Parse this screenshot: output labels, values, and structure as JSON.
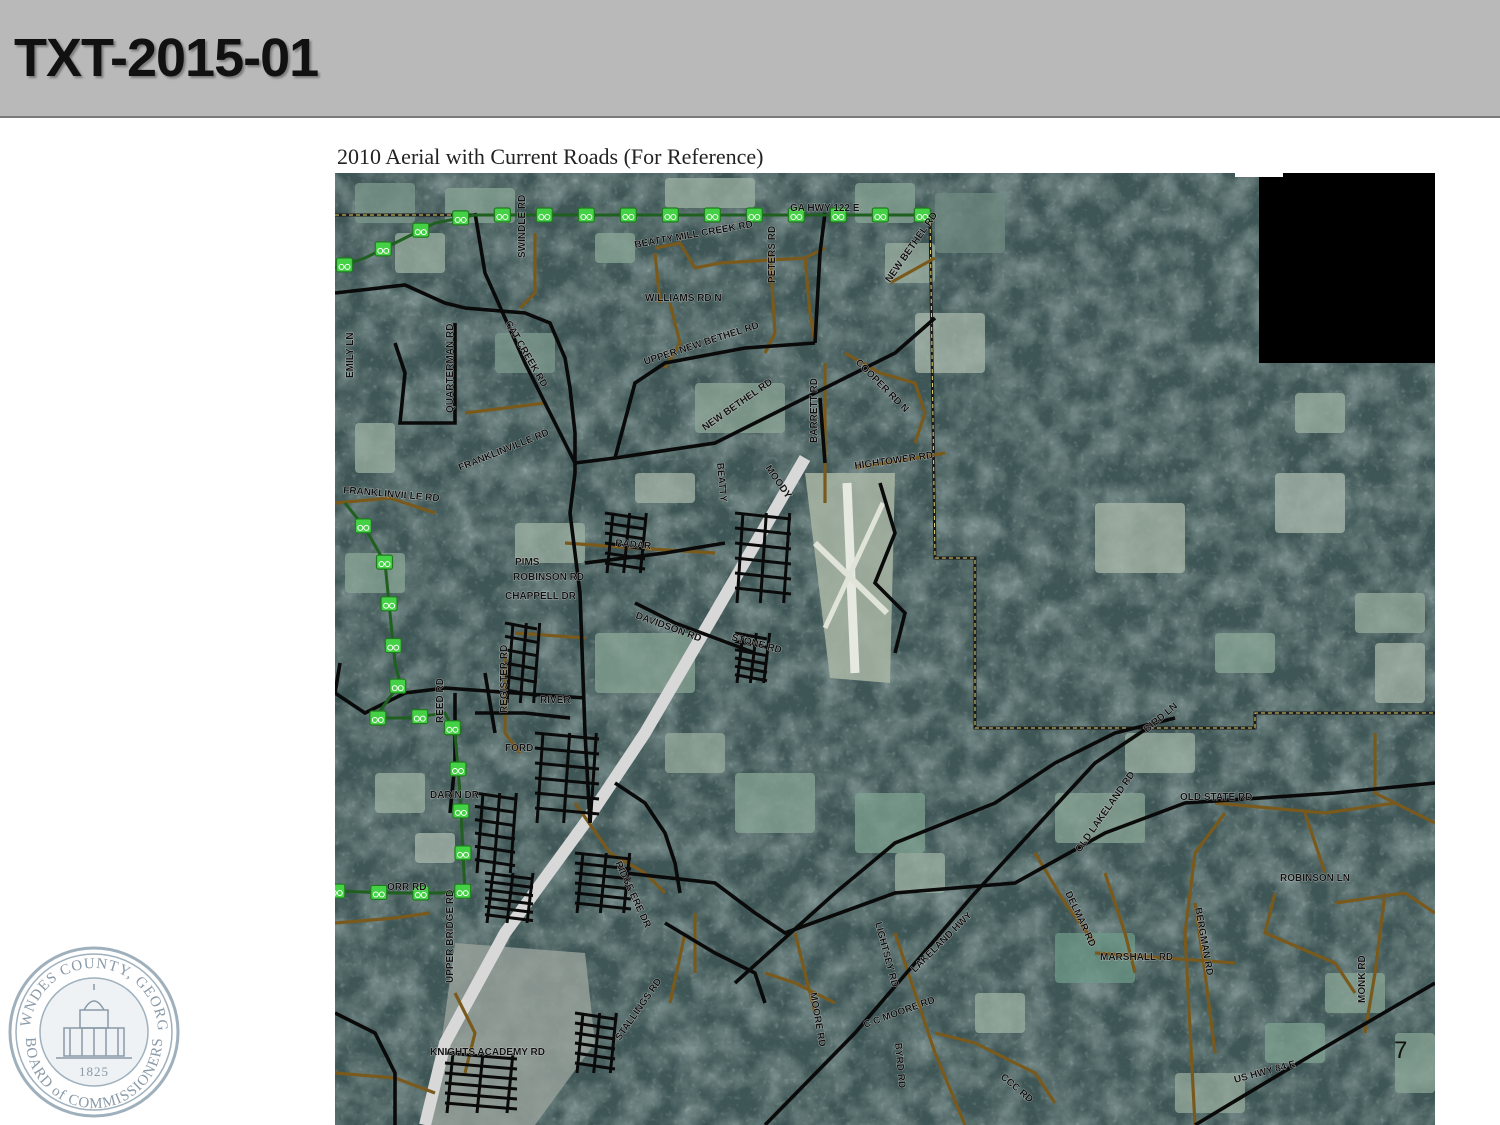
{
  "header": {
    "title": "TXT-2015-01"
  },
  "map": {
    "caption": "2010 Aerial with Current Roads (For Reference)",
    "colors": {
      "aerial_forest": "#3f5656",
      "aerial_field": "#7e9a8e",
      "aerial_clear": "#b9c4bb",
      "road_major": "#0a0a0a",
      "road_local": "#7a5a1c",
      "bike_route": "#3fcf3f",
      "highway": "#d8d8d8",
      "redacted": "#000000"
    },
    "icons": [
      "bike-route-marker-icon"
    ],
    "road_labels": [
      "GA HWY 122 E",
      "BEATTY MILL CREEK RD",
      "SWINDLE RD",
      "WILLIAMS RD N",
      "PETERS RD",
      "NEW BETHEL RD",
      "EMILY LN",
      "QUARTERMAN RD",
      "CAT CREEK RD",
      "UPPER NEW BETHEL RD",
      "COOPER RD N",
      "NEW BETHEL RD",
      "FRANKLINVILLE RD",
      "BARRETT RD",
      "HIGHTOWER RD",
      "FRANKLINVILLE RD",
      "MOODY",
      "BEATTY",
      "RADAR",
      "PIMS",
      "ROBINSON RD",
      "CHAPPELL DR",
      "DAVIDSON RD",
      "STONE RD",
      "REGISTER RD",
      "REED RD",
      "RIVER",
      "FORD",
      "DARIN DR",
      "ORR RD",
      "UPPER BRIDGE RD",
      "OLD STATE RD",
      "OLD LAKELAND RD",
      "BIRD LN",
      "ROBINSON LN",
      "DELMAR RD",
      "BERGMAN RD",
      "MARSHALL RD",
      "LIGHTSEY RD",
      "LAKELAND HWY",
      "MOORE RD",
      "C C MOORE RD",
      "BYRD RD",
      "CCC RD",
      "STALLINGS RD",
      "US HWY 84 E",
      "MONK RD",
      "KNIGHTS ACADEMY RD",
      "RIDGE ERE DR"
    ]
  },
  "footer": {
    "page_number": "7"
  },
  "seal": {
    "top_text": "LOWNDES COUNTY, GEORGIA",
    "bottom_text": "BOARD of COMMISSIONERS",
    "year": "1825"
  }
}
